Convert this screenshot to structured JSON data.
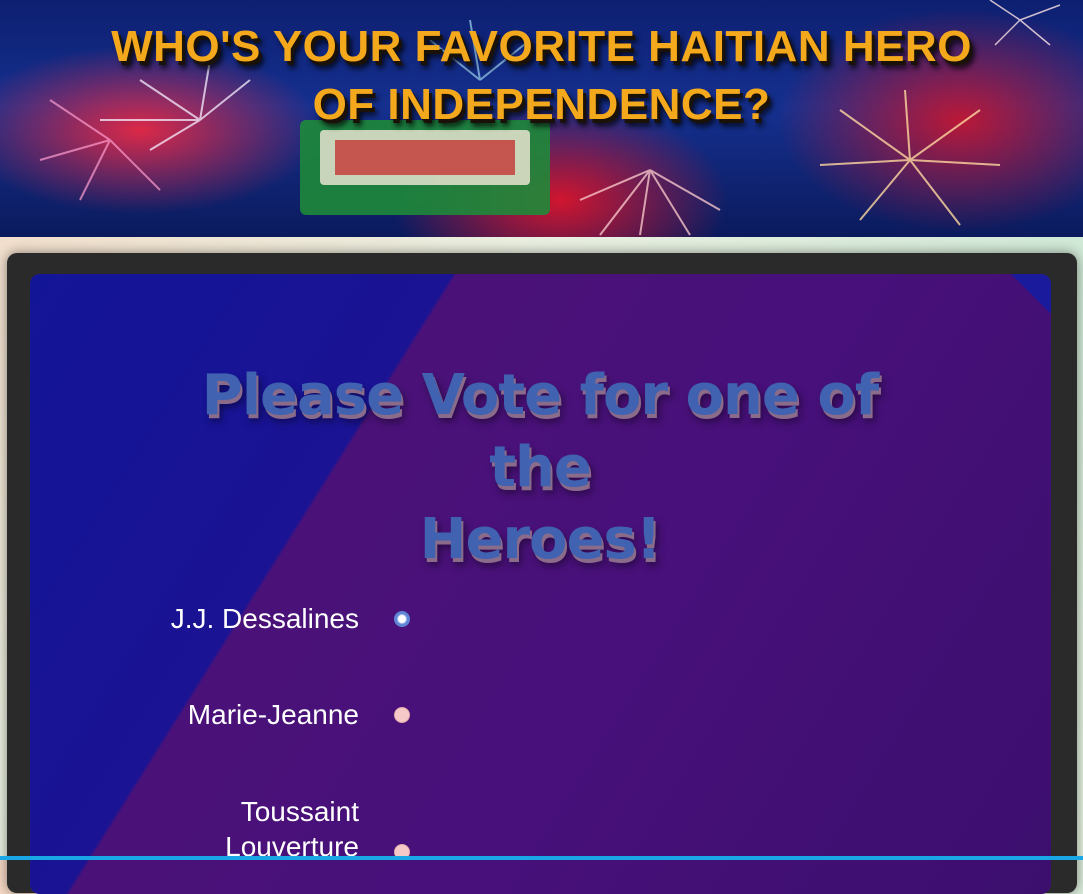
{
  "banner": {
    "title_line1": "WHO'S YOUR FAVORITE HAITIAN HERO",
    "title_line2": "OF INDEPENDENCE?"
  },
  "poll": {
    "heading_line1": "Please Vote for one of the",
    "heading_line2": "Heroes!",
    "options": [
      {
        "label": "J.J. Dessalines",
        "selected": true
      },
      {
        "label": "Marie-Jeanne",
        "selected": false
      },
      {
        "label": "Toussaint Louverture",
        "selected": false
      }
    ]
  },
  "colors": {
    "title": "#f4a81c",
    "heading": "#4062b0",
    "panel_blue": "#131597",
    "panel_purple": "#47107a",
    "radio_unselected": "#f6c9c9",
    "radio_selected_ring": "#5f86d6"
  }
}
